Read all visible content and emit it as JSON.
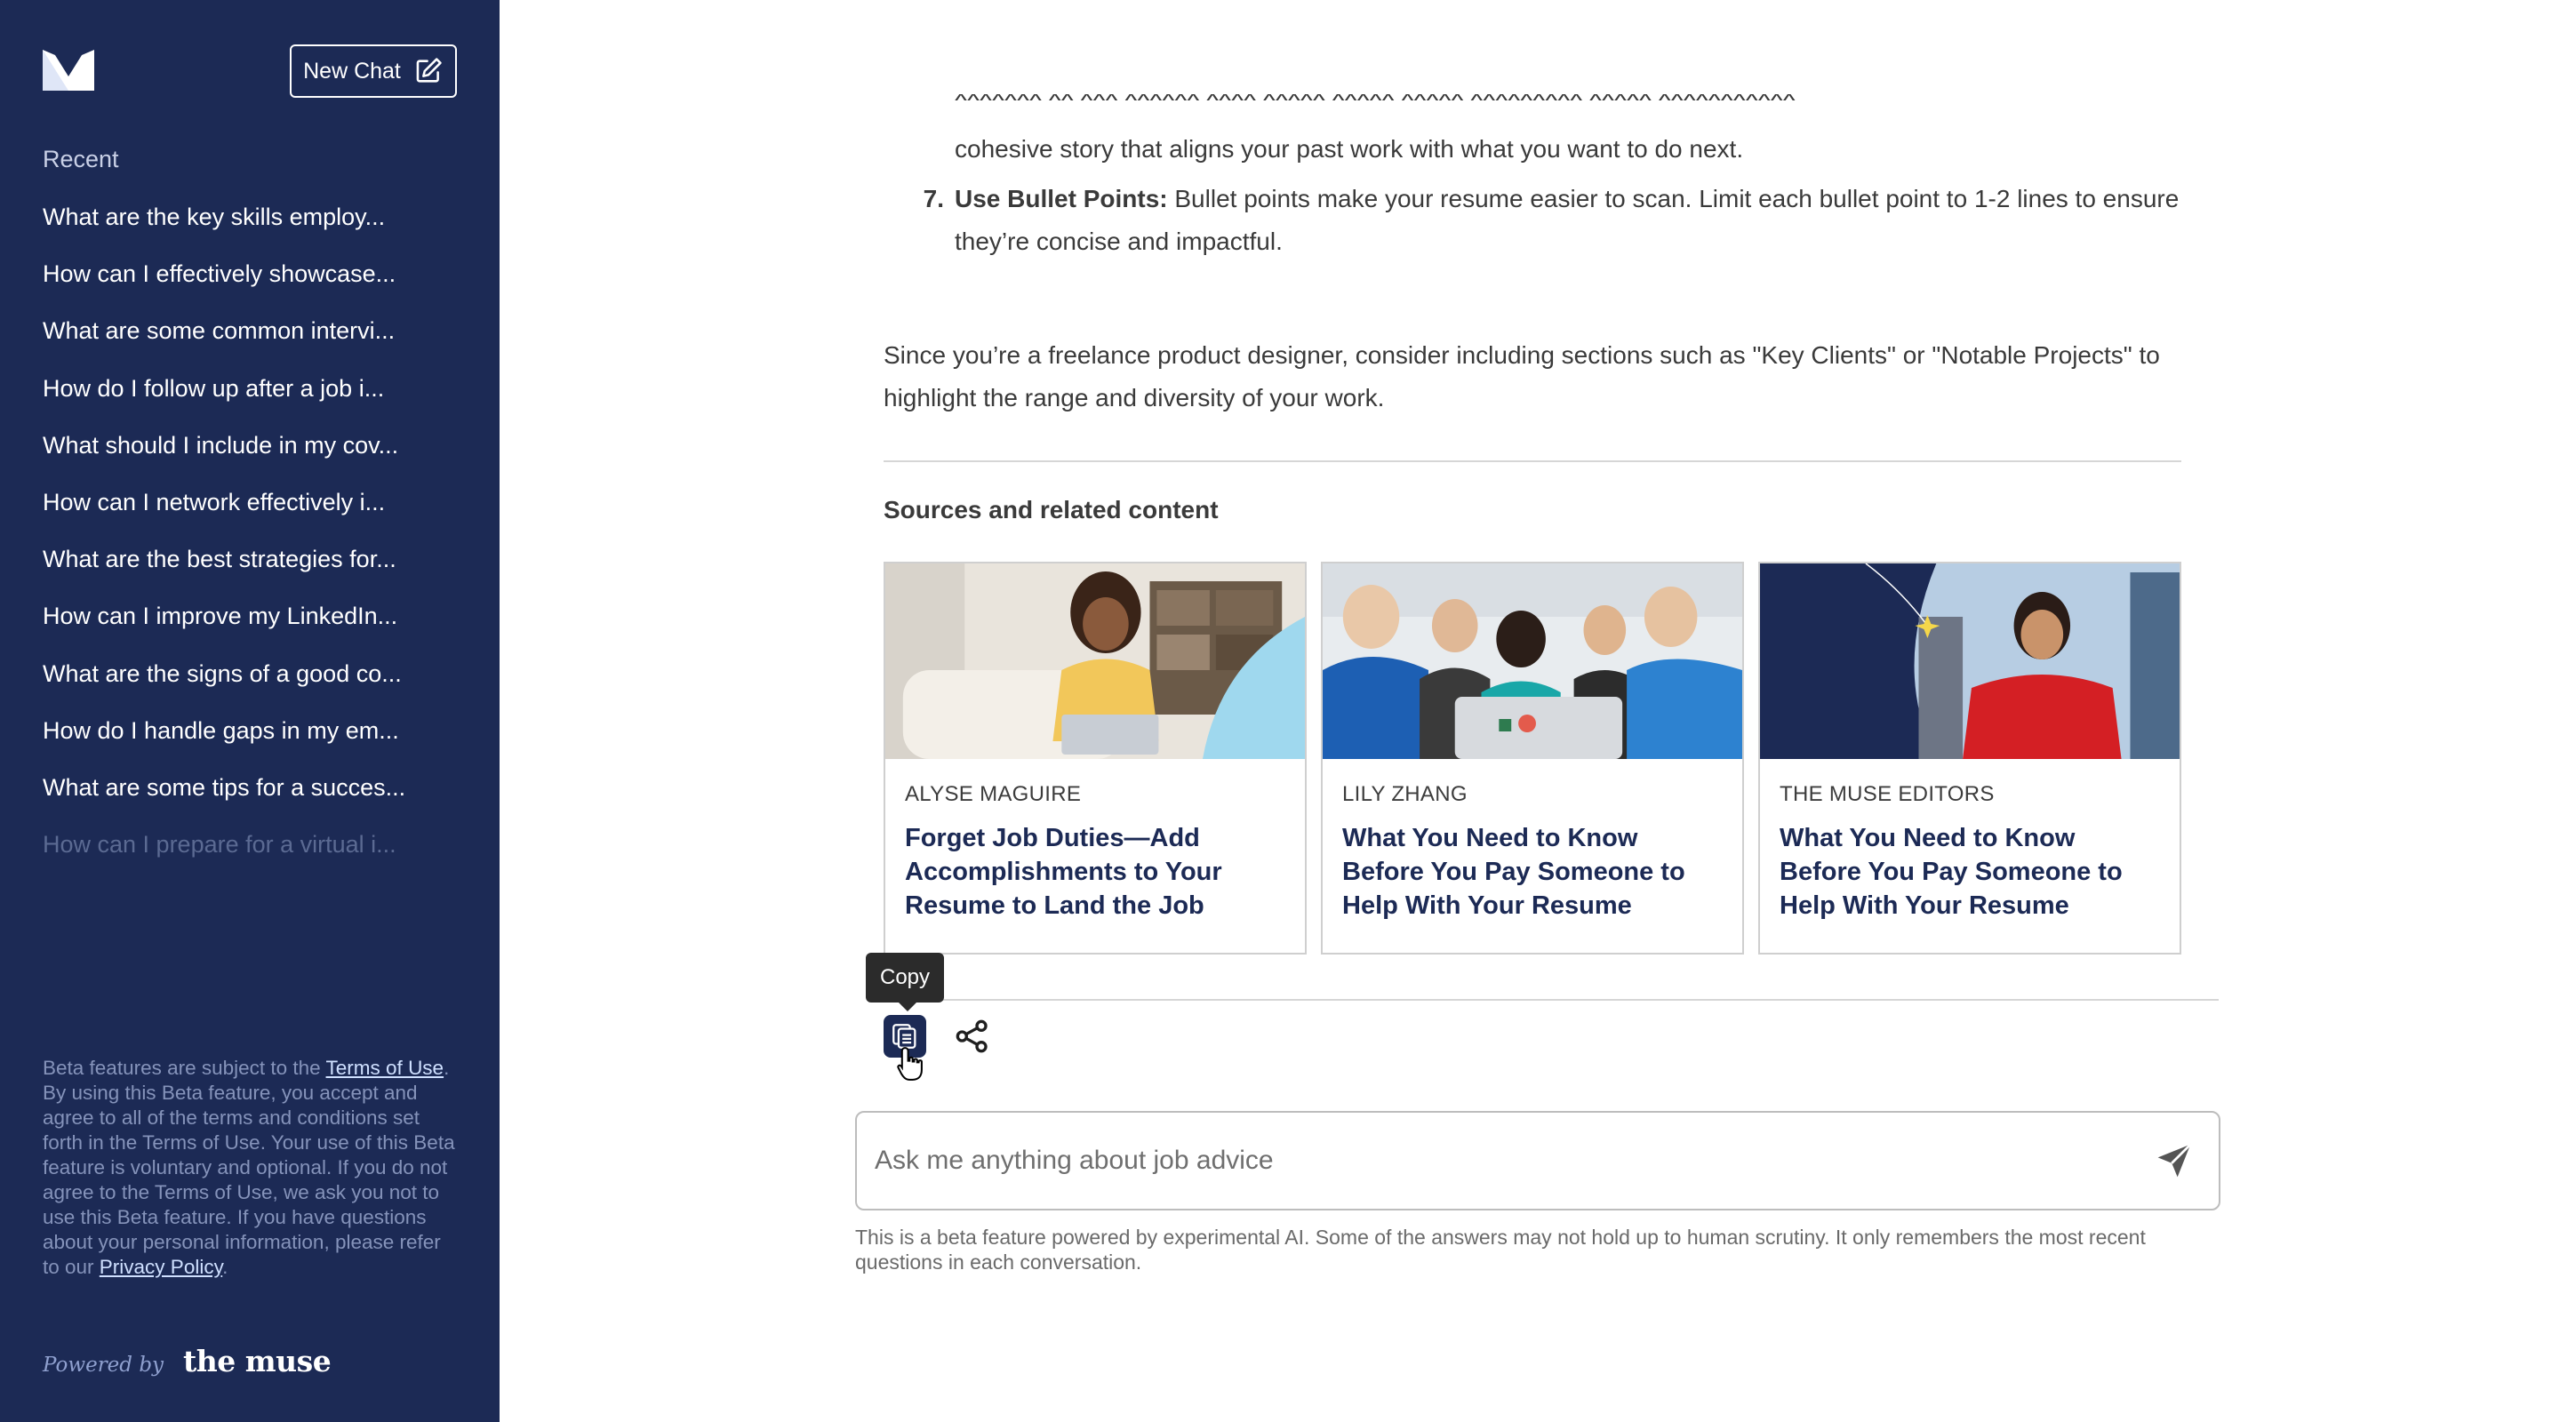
{
  "sidebar": {
    "new_chat_label": "New Chat",
    "recent_label": "Recent",
    "history": [
      "What are the key skills employ...",
      "How can I effectively showcase...",
      "What are some common intervi...",
      "How do I follow up after a job i...",
      "What should I include in my cov...",
      "How can I network effectively i...",
      "What are the best strategies for...",
      "How can I improve my LinkedIn...",
      "What are the signs of a good co...",
      "How do I handle gaps in my em...",
      "What are some tips for a succes...",
      "How can I prepare for a virtual i..."
    ],
    "disclaimer": {
      "prefix": "Beta features are subject to the ",
      "terms_link": "Terms of Use",
      "middle": ". By using this Beta feature, you accept and agree to all of the terms and conditions set forth in the Terms of Use. Your use of this Beta feature is voluntary and optional. If you do not agree to the Terms of Use, we ask you not to use this Beta feature. If you have questions about your personal information, please refer to our ",
      "privacy_link": "Privacy Policy",
      "suffix": "."
    },
    "powered_by": "Powered by",
    "brand": "the muse"
  },
  "answer": {
    "line_a": "cohesive story that aligns your past work with what you want to do next.",
    "item7": {
      "number": "7.",
      "bold": "Use Bullet Points:",
      "text": " Bullet points make your resume easier to scan. Limit each bullet point to 1-2 lines to ensure they’re concise and impactful."
    },
    "closing": "Since you’re a freelance product designer, consider including sections such as \"Key Clients\" or \"Notable Projects\" to highlight the range and diversity of your work."
  },
  "sources": {
    "title": "Sources and related content",
    "cards": [
      {
        "author": "ALYSE MAGUIRE",
        "title": "Forget Job Duties—Add Accomplishments to Your Resume to Land the Job"
      },
      {
        "author": "LILY ZHANG",
        "title": "What You Need to Know Before You Pay Someone to Help With Your Resume"
      },
      {
        "author": "THE MUSE EDITORS",
        "title": "What You Need to Know Before You Pay Someone to Help With Your Resume"
      }
    ]
  },
  "actions": {
    "copy_tooltip": "Copy"
  },
  "composer": {
    "placeholder": "Ask me anything about job advice",
    "beta_note": "This is a beta feature powered by experimental AI. Some of the answers may not hold up to human scrutiny. It only remembers the most recent questions in each conversation."
  },
  "colors": {
    "sidebar_bg": "#1c2a55",
    "title_navy": "#1c2a55",
    "link_light": "#cfe0ff"
  }
}
